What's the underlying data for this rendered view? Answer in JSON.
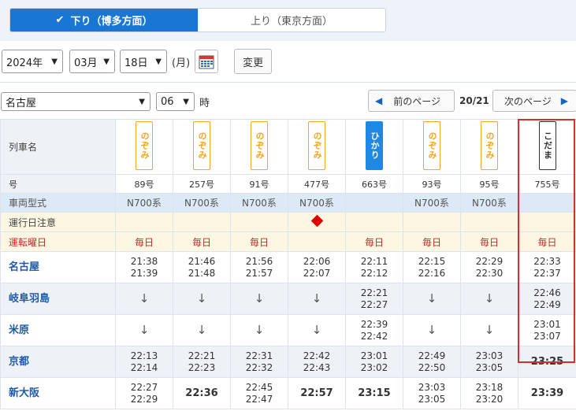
{
  "direction": {
    "down_label": "下り（博多方面）",
    "up_label": "上り（東京方面）"
  },
  "date": {
    "year": "2024年",
    "month": "03月",
    "day": "18日",
    "weekday": "(月)",
    "change_label": "変更"
  },
  "station_select": {
    "station": "名古屋",
    "hour": "06",
    "hour_suffix": "時"
  },
  "pager": {
    "prev_label": "前のページ",
    "page": "20/21",
    "next_label": "次のページ"
  },
  "row_labels": {
    "name": "列車名",
    "number": "号",
    "car_type": "車両型式",
    "notice": "運行日注意",
    "days": "運転曜日"
  },
  "trains": [
    {
      "kind": "nozomi",
      "name": "のぞみ",
      "number": "89号",
      "car": "N700系",
      "day": "毎日",
      "notice": ""
    },
    {
      "kind": "nozomi",
      "name": "のぞみ",
      "number": "257号",
      "car": "N700系",
      "day": "毎日",
      "notice": ""
    },
    {
      "kind": "nozomi",
      "name": "のぞみ",
      "number": "91号",
      "car": "N700系",
      "day": "毎日",
      "notice": ""
    },
    {
      "kind": "nozomi",
      "name": "のぞみ",
      "number": "477号",
      "car": "N700系",
      "day": "",
      "notice": "diamond"
    },
    {
      "kind": "hikari",
      "name": "ひかり",
      "number": "663号",
      "car": "",
      "day": "毎日",
      "notice": ""
    },
    {
      "kind": "nozomi",
      "name": "のぞみ",
      "number": "93号",
      "car": "N700系",
      "day": "毎日",
      "notice": ""
    },
    {
      "kind": "nozomi",
      "name": "のぞみ",
      "number": "95号",
      "car": "N700系",
      "day": "毎日",
      "notice": ""
    },
    {
      "kind": "kodama",
      "name": "こだま",
      "number": "755号",
      "car": "",
      "day": "毎日",
      "notice": ""
    }
  ],
  "stations": [
    {
      "name": "名古屋",
      "times": [
        [
          "21:38",
          "21:39"
        ],
        [
          "21:46",
          "21:48"
        ],
        [
          "21:56",
          "21:57"
        ],
        [
          "22:06",
          "22:07"
        ],
        [
          "22:11",
          "22:12"
        ],
        [
          "22:15",
          "22:16"
        ],
        [
          "22:29",
          "22:30"
        ],
        [
          "22:33",
          "22:37"
        ]
      ]
    },
    {
      "name": "岐阜羽島",
      "times": [
        [
          "↓"
        ],
        [
          "↓"
        ],
        [
          "↓"
        ],
        [
          "↓"
        ],
        [
          "22:21",
          "22:27"
        ],
        [
          "↓"
        ],
        [
          "↓"
        ],
        [
          "22:46",
          "22:49"
        ]
      ]
    },
    {
      "name": "米原",
      "times": [
        [
          "↓"
        ],
        [
          "↓"
        ],
        [
          "↓"
        ],
        [
          "↓"
        ],
        [
          "22:39",
          "22:42"
        ],
        [
          "↓"
        ],
        [
          "↓"
        ],
        [
          "23:01",
          "23:07"
        ]
      ]
    },
    {
      "name": "京都",
      "times": [
        [
          "22:13",
          "22:14"
        ],
        [
          "22:21",
          "22:23"
        ],
        [
          "22:31",
          "22:32"
        ],
        [
          "22:42",
          "22:43"
        ],
        [
          "23:01",
          "23:02"
        ],
        [
          "22:49",
          "22:50"
        ],
        [
          "23:03",
          "23:05"
        ],
        [
          "23:25"
        ]
      ]
    },
    {
      "name": "新大阪",
      "times": [
        [
          "22:27",
          "22:29"
        ],
        [
          "22:36"
        ],
        [
          "22:45",
          "22:47"
        ],
        [
          "22:57"
        ],
        [
          "23:15"
        ],
        [
          "23:03",
          "23:05"
        ],
        [
          "23:18",
          "23:20"
        ],
        [
          "23:39"
        ]
      ]
    }
  ],
  "colors": {
    "active_tab": "#1976d2",
    "nozomi": "#f5a623",
    "hikari": "#1e88e5",
    "highlight": "#d32f2f",
    "station_link": "#1f5aa6",
    "day_text": "#c62828"
  }
}
